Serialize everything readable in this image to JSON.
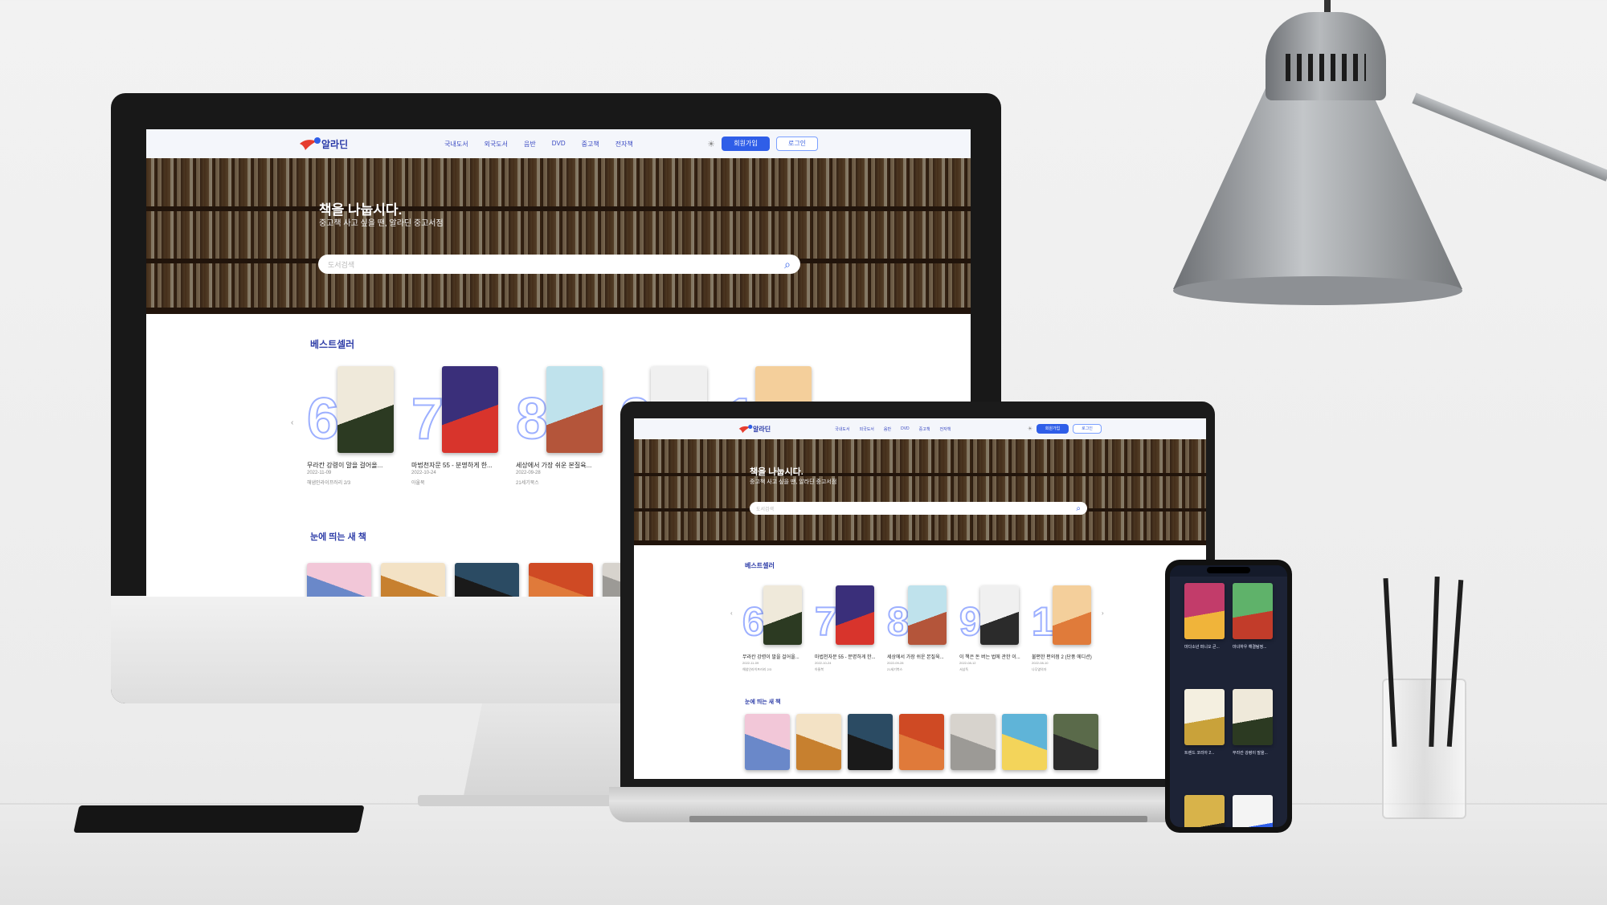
{
  "site": {
    "logo_text": "알라딘",
    "nav": [
      "국내도서",
      "외국도서",
      "음반",
      "DVD",
      "중고책",
      "전자책"
    ],
    "join_label": "회원가입",
    "login_label": "로그인",
    "hero_title": "책을 나눕시다.",
    "hero_subtitle": "중고책 사고 싶을 땐, 알라딘 중고서점",
    "search_placeholder": "도서검색",
    "bestseller_title": "베스트셀러",
    "new_books_title": "눈에 띄는 새 책"
  },
  "bestsellers": [
    {
      "rank": "6",
      "title": "무라칸 강령이 말을 걸어올...",
      "date": "2022-11-09",
      "publisher": "해냄인라이프러리 2/3",
      "colors": [
        "#efe9da",
        "#2c3a22"
      ]
    },
    {
      "rank": "7",
      "title": "마법천자문 55 - 분명하게 한...",
      "date": "2022-10-24",
      "publisher": "아울북",
      "colors": [
        "#3a2f7a",
        "#d8342c"
      ]
    },
    {
      "rank": "8",
      "title": "세상에서 가장 쉬운 본질육...",
      "date": "2022-09-28",
      "publisher": "21세기북스",
      "colors": [
        "#bfe2ec",
        "#b4553a"
      ]
    },
    {
      "rank": "9",
      "title": "이 책은 돈 버는 법에 관한 이...",
      "date": "2022-08-12",
      "publisher": "서삼독",
      "colors": [
        "#f0f0f0",
        "#2b2b2b"
      ]
    },
    {
      "rank": "10",
      "title": "불편한 편의점 2 (단풍 에디션)",
      "date": "2022-08-10",
      "publisher": "나무옆의자",
      "colors": [
        "#f4cf9b",
        "#e07b3a"
      ]
    }
  ],
  "new_books": [
    {
      "colors": [
        "#f2c7d8",
        "#6a88c9"
      ]
    },
    {
      "colors": [
        "#f3e2c5",
        "#c7802f"
      ]
    },
    {
      "colors": [
        "#2b4b63",
        "#1a1a1a"
      ]
    },
    {
      "colors": [
        "#cf4a24",
        "#e07a3a"
      ]
    },
    {
      "colors": [
        "#d7d3cd",
        "#9c9a96"
      ]
    },
    {
      "colors": [
        "#5fb4d8",
        "#f3d45a"
      ]
    },
    {
      "colors": [
        "#5a6a4a",
        "#2b2b2b"
      ]
    }
  ],
  "phone_books": [
    {
      "title": "마다소년 퍼니오 큰...",
      "colors": [
        "#c23c6a",
        "#f0b43a"
      ]
    },
    {
      "title": "마녀하우 해결탐정...",
      "colors": [
        "#5fb26a",
        "#c23c2a"
      ]
    },
    {
      "title": "트렌드 코리아 2...",
      "colors": [
        "#f4efe0",
        "#c9a23a"
      ]
    },
    {
      "title": "무라칸 강령이 말을...",
      "colors": [
        "#efe9da",
        "#2c3a22"
      ]
    },
    {
      "title": "",
      "colors": [
        "#d8b34a",
        "#1d1d1d"
      ]
    },
    {
      "title": "",
      "colors": [
        "#f4f4f4",
        "#2f5ee8"
      ]
    }
  ],
  "colors": {
    "brand": "#2f5ee8",
    "accent_text": "#2f3ea8",
    "nav_text": "#3848c2"
  }
}
